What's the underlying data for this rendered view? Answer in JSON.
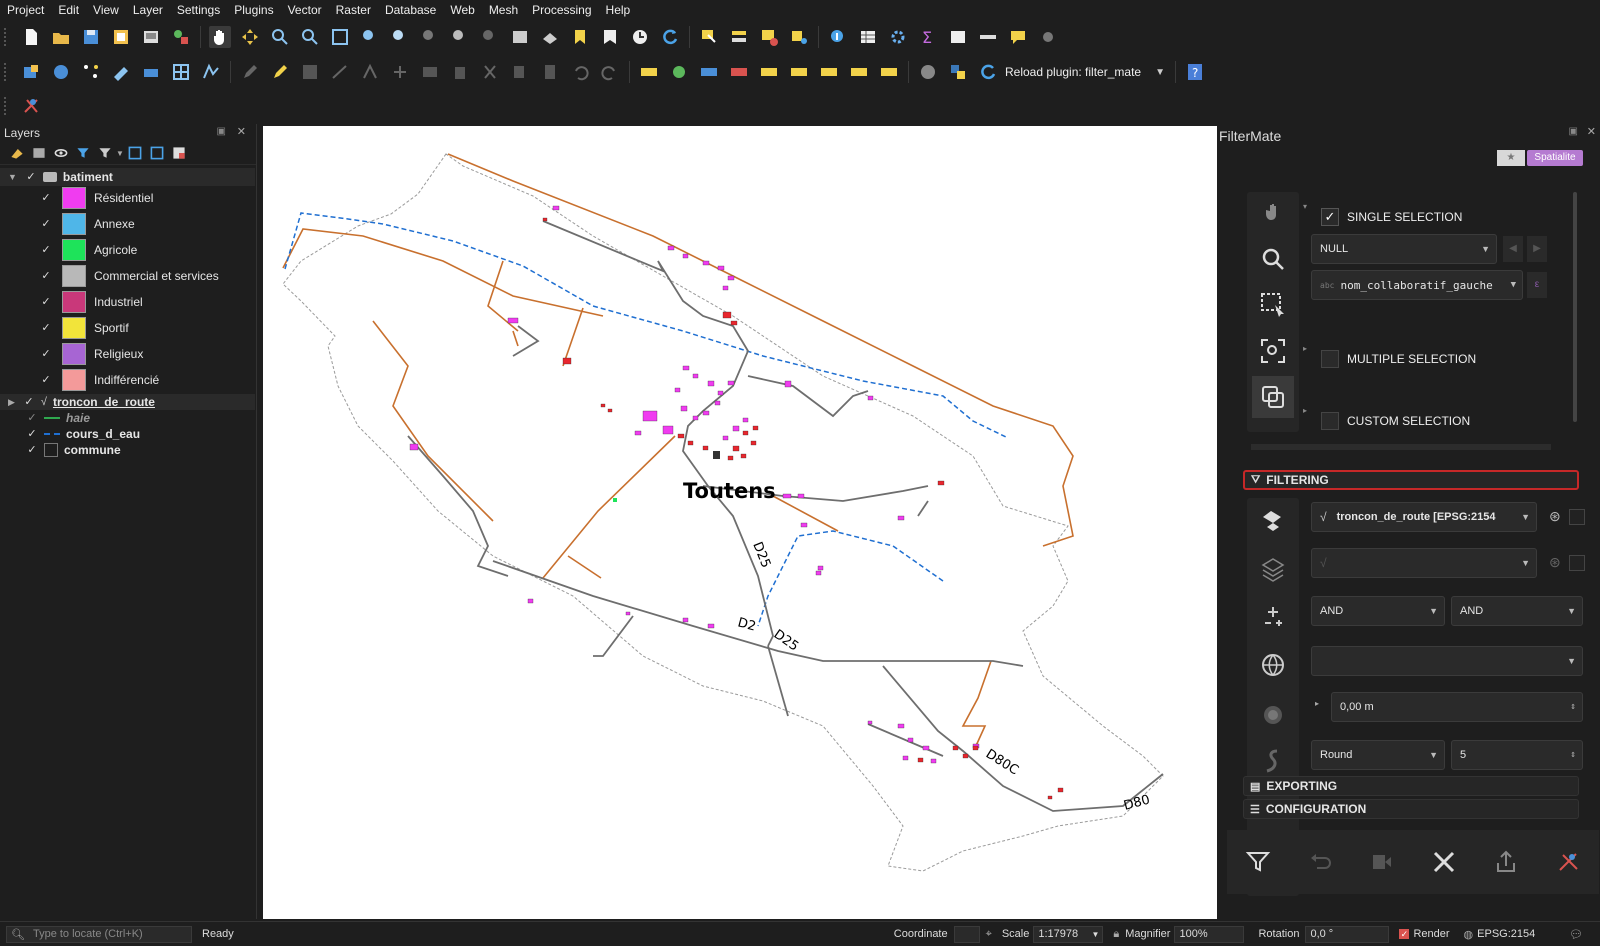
{
  "menu": [
    "Project",
    "Edit",
    "View",
    "Layer",
    "Settings",
    "Plugins",
    "Vector",
    "Raster",
    "Database",
    "Web",
    "Mesh",
    "Processing",
    "Help"
  ],
  "toolbar": {
    "reload_plugin_label": "Reload plugin: filter_mate"
  },
  "layers_panel": {
    "title": "Layers",
    "groups": [
      {
        "name": "batiment",
        "expanded": true,
        "checked": true
      },
      {
        "name": "troncon_de_route",
        "checked": true
      },
      {
        "name": "haie",
        "checked": true
      },
      {
        "name": "cours_d_eau",
        "checked": true
      },
      {
        "name": "commune",
        "checked": true
      }
    ],
    "batiment_classes": [
      {
        "label": "Résidentiel",
        "color": "#f03cf0"
      },
      {
        "label": "Annexe",
        "color": "#4fb6e8"
      },
      {
        "label": "Agricole",
        "color": "#1ee35a"
      },
      {
        "label": "Commercial et services",
        "color": "#b8b8b8"
      },
      {
        "label": "Industriel",
        "color": "#c9387a"
      },
      {
        "label": "Sportif",
        "color": "#f2e43a"
      },
      {
        "label": "Religieux",
        "color": "#a765d3"
      },
      {
        "label": "Indifférencié",
        "color": "#f39a9a"
      }
    ]
  },
  "map": {
    "place_label": "Toutens",
    "road_labels": [
      "D25",
      "D2",
      "D25",
      "D80C",
      "D80"
    ]
  },
  "filtermate": {
    "title": "FilterMate",
    "badge_star": "★",
    "badge_backend": "Spatialite",
    "single_selection": "SINGLE SELECTION",
    "single_value": "NULL",
    "field_type": "abc",
    "field_name": "nom_collaboratif_gauche",
    "multiple_selection": "MULTIPLE SELECTION",
    "custom_selection": "CUSTOM SELECTION",
    "filtering": "FILTERING",
    "layer_combo": "troncon_de_route [EPSG:2154",
    "operator_1": "AND",
    "operator_2": "AND",
    "buffer_value": "0,00 m",
    "buffer_style": "Round",
    "segments": "5",
    "exporting": "EXPORTING",
    "configuration": "CONFIGURATION",
    "accent_color": "#c62828",
    "badge_color": "#b57bd1"
  },
  "statusbar": {
    "locate_placeholder": "Type to locate (Ctrl+K)",
    "ready": "Ready",
    "coordinate_label": "Coordinate",
    "scale_label": "Scale",
    "scale_value": "1:17978",
    "magnifier_label": "Magnifier",
    "magnifier_value": "100%",
    "rotation_label": "Rotation",
    "rotation_value": "0,0 °",
    "render_label": "Render",
    "crs": "EPSG:2154"
  }
}
